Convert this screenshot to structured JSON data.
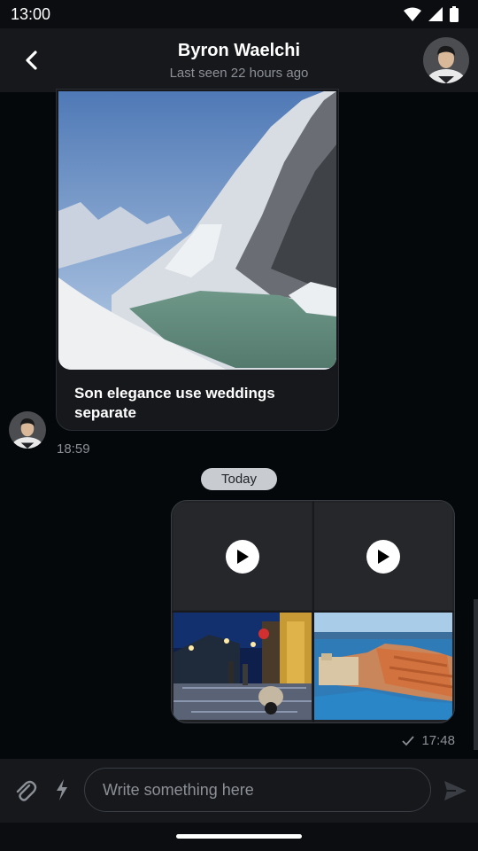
{
  "status_bar": {
    "time": "13:00"
  },
  "header": {
    "contact_name": "Byron Waelchi",
    "last_seen": "Last seen 22 hours ago"
  },
  "messages": {
    "incoming": {
      "caption": "Son elegance use weddings separate",
      "time": "18:59"
    },
    "date_separator": "Today",
    "outgoing": {
      "time": "17:48",
      "media": [
        {
          "kind": "video"
        },
        {
          "kind": "video"
        },
        {
          "kind": "photo"
        },
        {
          "kind": "photo"
        }
      ]
    }
  },
  "composer": {
    "placeholder": "Write something here"
  },
  "colors": {
    "background": "#05080b",
    "surface": "#16181c",
    "muted_text": "#8c9096",
    "date_pill": "#c8cbd0"
  }
}
